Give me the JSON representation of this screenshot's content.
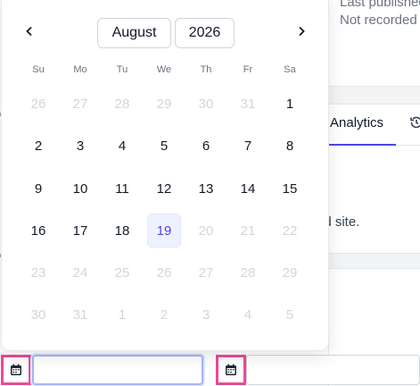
{
  "background": {
    "last_published_label": "Last published",
    "not_recorded": "Not recorded",
    "tab_analytics": "Analytics",
    "site_text": "ed site."
  },
  "calendar": {
    "month": "August",
    "year": "2026",
    "weekdays": [
      "Su",
      "Mo",
      "Tu",
      "We",
      "Th",
      "Fr",
      "Sa"
    ],
    "weeks": [
      [
        {
          "d": "26",
          "m": true
        },
        {
          "d": "27",
          "m": true
        },
        {
          "d": "28",
          "m": true
        },
        {
          "d": "29",
          "m": true
        },
        {
          "d": "30",
          "m": true
        },
        {
          "d": "31",
          "m": true
        },
        {
          "d": "1",
          "m": false
        }
      ],
      [
        {
          "d": "2",
          "m": false
        },
        {
          "d": "3",
          "m": false
        },
        {
          "d": "4",
          "m": false
        },
        {
          "d": "5",
          "m": false
        },
        {
          "d": "6",
          "m": false
        },
        {
          "d": "7",
          "m": false
        },
        {
          "d": "8",
          "m": false
        }
      ],
      [
        {
          "d": "9",
          "m": false
        },
        {
          "d": "10",
          "m": false
        },
        {
          "d": "11",
          "m": false
        },
        {
          "d": "12",
          "m": false
        },
        {
          "d": "13",
          "m": false
        },
        {
          "d": "14",
          "m": false
        },
        {
          "d": "15",
          "m": false
        }
      ],
      [
        {
          "d": "16",
          "m": false
        },
        {
          "d": "17",
          "m": false
        },
        {
          "d": "18",
          "m": false
        },
        {
          "d": "19",
          "m": false,
          "today": true
        },
        {
          "d": "20",
          "m": true
        },
        {
          "d": "21",
          "m": true
        },
        {
          "d": "22",
          "m": true
        }
      ],
      [
        {
          "d": "23",
          "m": true
        },
        {
          "d": "24",
          "m": true
        },
        {
          "d": "25",
          "m": true
        },
        {
          "d": "26",
          "m": true
        },
        {
          "d": "27",
          "m": true
        },
        {
          "d": "28",
          "m": true
        },
        {
          "d": "29",
          "m": true
        }
      ],
      [
        {
          "d": "30",
          "m": true
        },
        {
          "d": "31",
          "m": true
        },
        {
          "d": "1",
          "m": true
        },
        {
          "d": "2",
          "m": true
        },
        {
          "d": "3",
          "m": true
        },
        {
          "d": "4",
          "m": true
        },
        {
          "d": "5",
          "m": true
        }
      ]
    ]
  },
  "inputs": {
    "start_value": "",
    "end_value": ""
  },
  "icons": {
    "prev": "chevron-left-icon",
    "next": "chevron-right-icon",
    "calendar": "calendar-icon",
    "history": "history-icon"
  },
  "colors": {
    "accent": "#4f46e5",
    "today_bg": "#eef2ff",
    "highlight": "#ec4899"
  }
}
